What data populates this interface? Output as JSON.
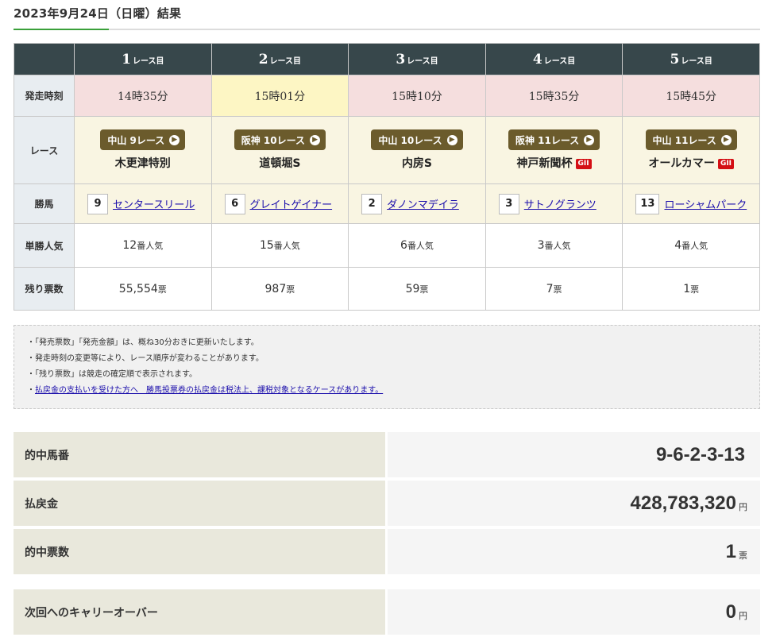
{
  "page": {
    "title": "2023年9月24日（日曜）結果"
  },
  "table": {
    "header_suffix": "レース目",
    "race_numbers": [
      "1",
      "2",
      "3",
      "4",
      "5"
    ],
    "row_labels": {
      "time": "発走時刻",
      "race": "レース",
      "winner": "勝馬",
      "popularity": "単勝人気",
      "remaining": "残り票数"
    },
    "races": [
      {
        "time": "14時35分",
        "venue": "中山 9レース",
        "name": "木更津特別",
        "grade": "",
        "horse_no": "9",
        "horse": "センタースリール",
        "pop": "12",
        "pop_unit": "番人気",
        "left": "55,554",
        "left_unit": "票"
      },
      {
        "time": "15時01分",
        "venue": "阪神 10レース",
        "name": "道頓堀S",
        "grade": "",
        "horse_no": "6",
        "horse": "グレイトゲイナー",
        "pop": "15",
        "pop_unit": "番人気",
        "left": "987",
        "left_unit": "票"
      },
      {
        "time": "15時10分",
        "venue": "中山 10レース",
        "name": "内房S",
        "grade": "",
        "horse_no": "2",
        "horse": "ダノンマデイラ",
        "pop": "6",
        "pop_unit": "番人気",
        "left": "59",
        "left_unit": "票"
      },
      {
        "time": "15時35分",
        "venue": "阪神 11レース",
        "name": "神戸新聞杯",
        "grade": "GII",
        "horse_no": "3",
        "horse": "サトノグランツ",
        "pop": "3",
        "pop_unit": "番人気",
        "left": "7",
        "left_unit": "票"
      },
      {
        "time": "15時45分",
        "venue": "中山 11レース",
        "name": "オールカマー",
        "grade": "GII",
        "horse_no": "13",
        "horse": "ローシャムパーク",
        "pop": "4",
        "pop_unit": "番人気",
        "left": "1",
        "left_unit": "票"
      }
    ],
    "highlight_time_index": 1
  },
  "notes": [
    "「発売票数」「発売金額」は、概ね30分おきに更新いたします。",
    "発走時刻の変更等により、レース順序が変わることがあります。",
    "「残り票数」は競走の確定順で表示されます。"
  ],
  "notes_link": "払戻金の支払いを受けた方へ　勝馬投票券の払戻金は税法上、課税対象となるケースがあります。",
  "results": [
    {
      "label": "的中馬番",
      "value": "9-6-2-3-13",
      "unit": ""
    },
    {
      "label": "払戻金",
      "value": "428,783,320",
      "unit": "円"
    },
    {
      "label": "的中票数",
      "value": "1",
      "unit": "票"
    },
    {
      "label": "次回へのキャリーオーバー",
      "value": "0",
      "unit": "円"
    }
  ],
  "colors": {
    "header": "#37474b",
    "accent": "#3aa03a",
    "pill": "#6b5b2c",
    "grade": "#d40f14",
    "time_cell": "#f5dede",
    "time_highlight": "#fdf6c4"
  }
}
